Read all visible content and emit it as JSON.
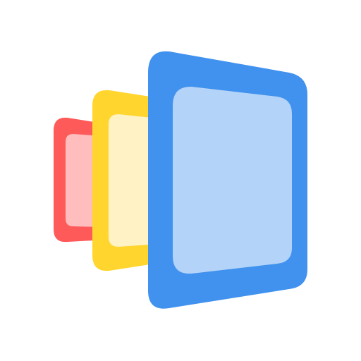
{
  "icon": {
    "name": "stacked-pages-app-icon",
    "colors": {
      "background": "#ffffff",
      "red_frame": "#FF5A5A",
      "red_fill": "#FFBDBD",
      "yellow_frame": "#FFD52E",
      "yellow_fill": "#FFF2C4",
      "blue_frame": "#4192EE",
      "blue_fill": "#B3D3F8"
    }
  }
}
